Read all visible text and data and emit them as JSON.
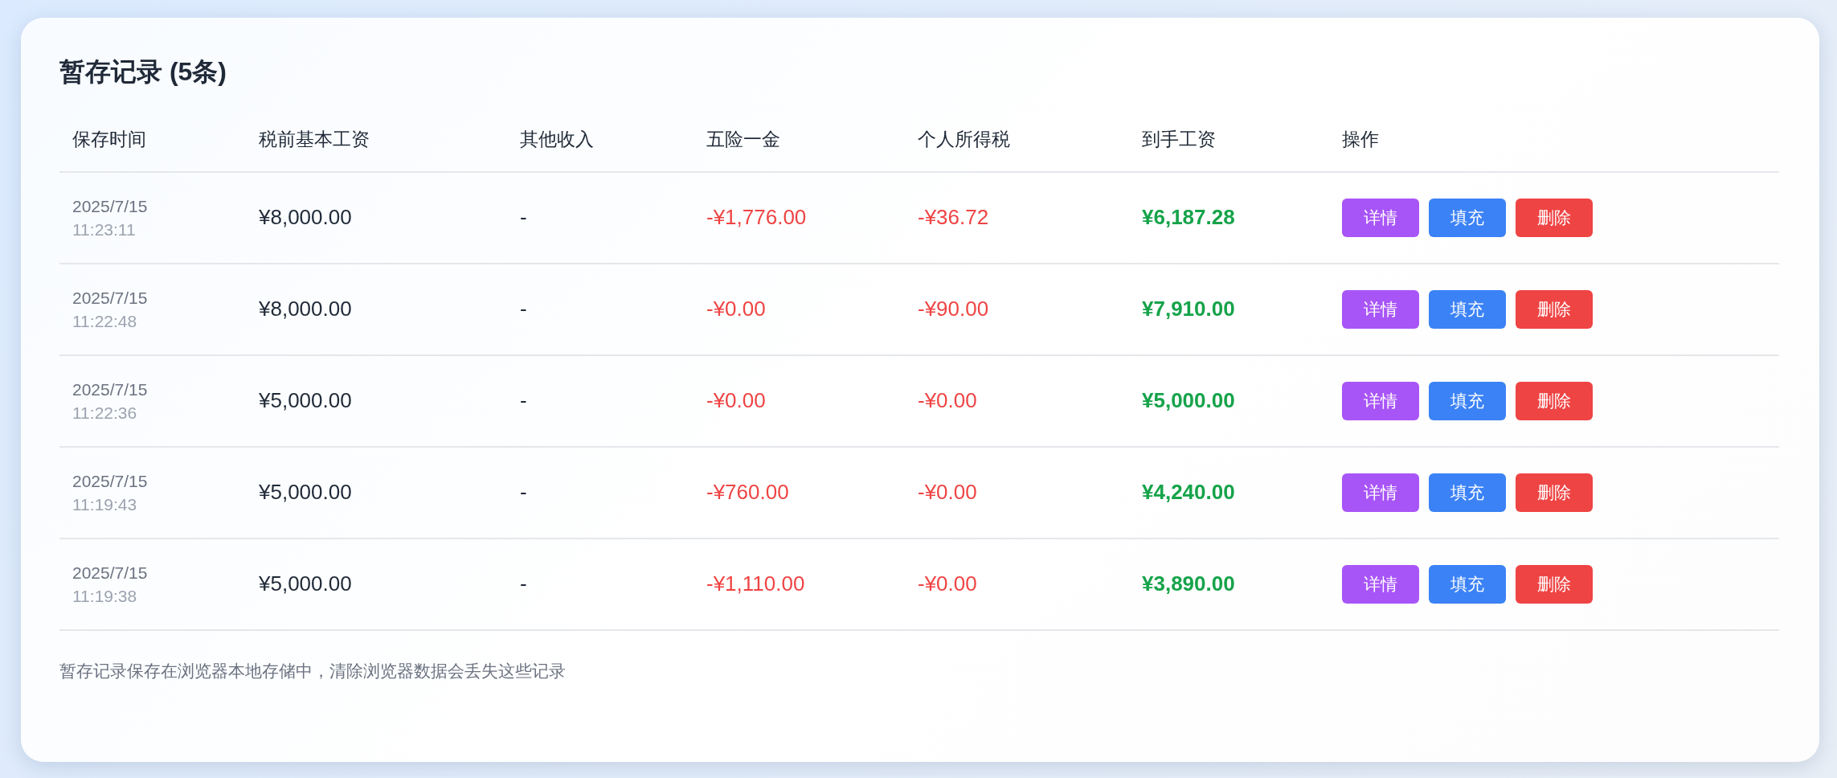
{
  "title": "暂存记录 (5条)",
  "columns": [
    "保存时间",
    "税前基本工资",
    "其他收入",
    "五险一金",
    "个人所得税",
    "到手工资",
    "操作"
  ],
  "rows": [
    {
      "date": "2025/7/15",
      "time": "11:23:11",
      "base": "¥8,000.00",
      "other": "-",
      "insurance": "-¥1,776.00",
      "tax": "-¥36.72",
      "net": "¥6,187.28",
      "actions": [
        {
          "label": "详情",
          "kind": "detail"
        },
        {
          "label": "填充",
          "kind": "fill"
        },
        {
          "label": "删除",
          "kind": "delete"
        }
      ]
    },
    {
      "date": "2025/7/15",
      "time": "11:22:48",
      "base": "¥8,000.00",
      "other": "-",
      "insurance": "-¥0.00",
      "tax": "-¥90.00",
      "net": "¥7,910.00",
      "actions": [
        {
          "label": "详情",
          "kind": "detail"
        },
        {
          "label": "填充",
          "kind": "fill"
        },
        {
          "label": "删除",
          "kind": "delete"
        }
      ]
    },
    {
      "date": "2025/7/15",
      "time": "11:22:36",
      "base": "¥5,000.00",
      "other": "-",
      "insurance": "-¥0.00",
      "tax": "-¥0.00",
      "net": "¥5,000.00",
      "actions": [
        {
          "label": "详情",
          "kind": "detail"
        },
        {
          "label": "填充",
          "kind": "fill"
        },
        {
          "label": "删除",
          "kind": "delete"
        }
      ]
    },
    {
      "date": "2025/7/15",
      "time": "11:19:43",
      "base": "¥5,000.00",
      "other": "-",
      "insurance": "-¥760.00",
      "tax": "-¥0.00",
      "net": "¥4,240.00",
      "actions": [
        {
          "label": "详情",
          "kind": "detail"
        },
        {
          "label": "填充",
          "kind": "fill"
        },
        {
          "label": "删除",
          "kind": "delete"
        }
      ]
    },
    {
      "date": "2025/7/15",
      "time": "11:19:38",
      "base": "¥5,000.00",
      "other": "-",
      "insurance": "-¥1,110.00",
      "tax": "-¥0.00",
      "net": "¥3,890.00",
      "actions": [
        {
          "label": "详情",
          "kind": "detail"
        },
        {
          "label": "填充",
          "kind": "fill"
        },
        {
          "label": "删除",
          "kind": "delete"
        }
      ]
    }
  ],
  "footnote": "暂存记录保存在浏览器本地存储中，清除浏览器数据会丢失这些记录"
}
